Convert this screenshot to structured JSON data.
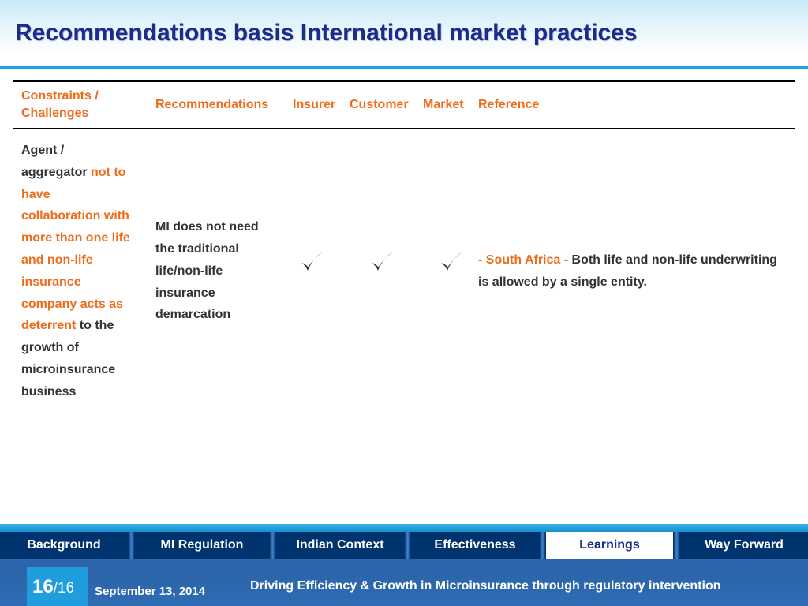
{
  "slide": {
    "title": "Recommendations basis International market practices"
  },
  "table": {
    "headers": [
      "Constraints / Challenges",
      "Recommendations",
      "Insurer",
      "Customer",
      "Market",
      "Reference"
    ],
    "row": {
      "constraint_prefix": "Agent / aggregator ",
      "constraint_highlight": "not to have collaboration with more than one life and non-life insurance company acts as deterrent",
      "constraint_suffix": " to the growth of microinsurance business",
      "recommendation": "MI does not need the traditional life/non-life insurance demarcation",
      "insurer": true,
      "customer": true,
      "market": true,
      "reference_highlight": "- South Africa - ",
      "reference_text": "Both life and non-life underwriting is allowed by a single entity."
    }
  },
  "nav": {
    "items": [
      "Background",
      "MI Regulation",
      "Indian Context",
      "Effectiveness",
      "Learnings",
      "Way Forward"
    ],
    "active": "Learnings"
  },
  "footer": {
    "page_current": "16",
    "page_total": "/16",
    "date": "September 13, 2014",
    "text": "Driving Efficiency & Growth in Microinsurance through regulatory intervention"
  },
  "icons": {
    "check": "check-icon"
  },
  "colors": {
    "title": "#1a2c8c",
    "accent_orange": "#ef6c1a",
    "nav_dark": "#00346f",
    "footer_blue": "#2e6cb4",
    "page_box": "#1f9ddd",
    "title_rule": "#1ba5df"
  }
}
